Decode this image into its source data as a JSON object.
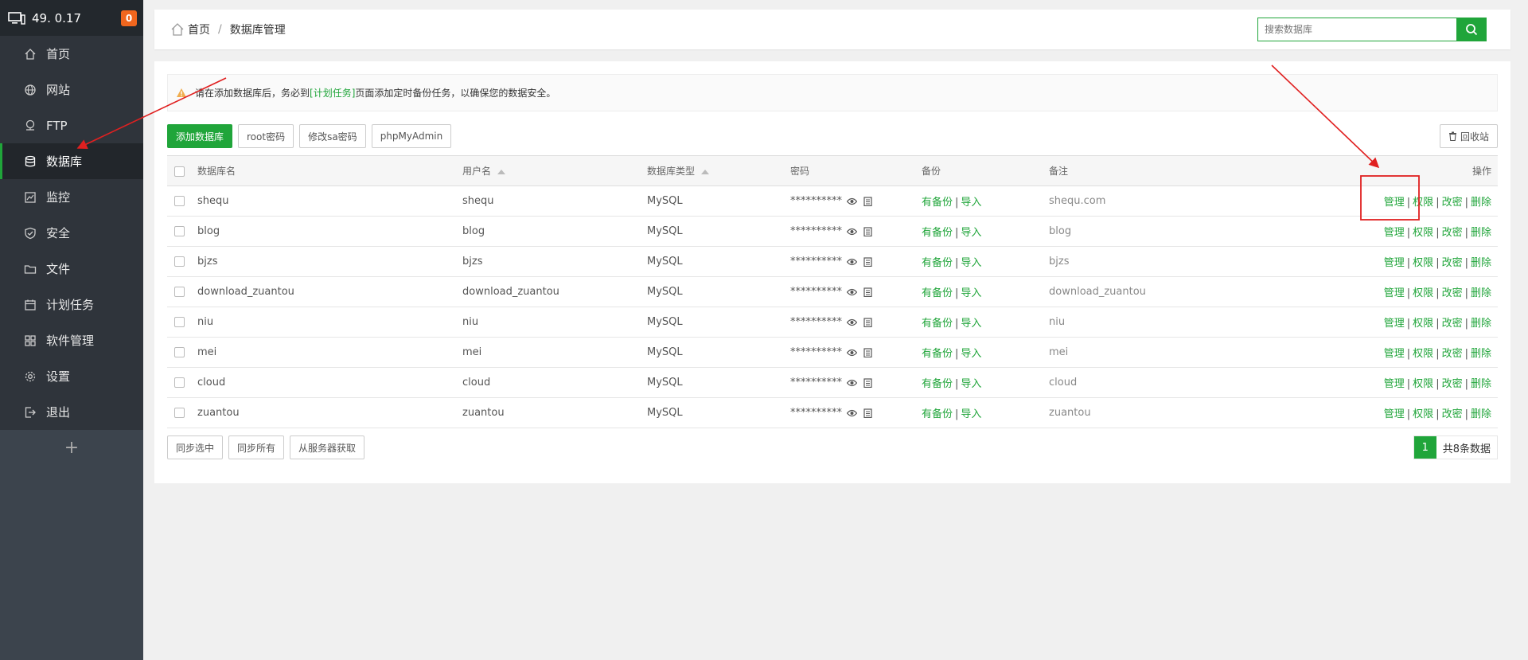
{
  "sidebar": {
    "ip": "49.    0.17",
    "badge": "0",
    "items": [
      {
        "label": "首页",
        "icon": "home-icon"
      },
      {
        "label": "网站",
        "icon": "globe-icon"
      },
      {
        "label": "FTP",
        "icon": "ftp-icon"
      },
      {
        "label": "数据库",
        "icon": "database-icon",
        "active": true
      },
      {
        "label": "监控",
        "icon": "monitor-icon"
      },
      {
        "label": "安全",
        "icon": "shield-icon"
      },
      {
        "label": "文件",
        "icon": "folder-icon"
      },
      {
        "label": "计划任务",
        "icon": "calendar-icon"
      },
      {
        "label": "软件管理",
        "icon": "apps-icon"
      },
      {
        "label": "设置",
        "icon": "gear-icon"
      },
      {
        "label": "退出",
        "icon": "logout-icon"
      }
    ],
    "add": "+"
  },
  "header": {
    "home": "首页",
    "sep": "/",
    "current": "数据库管理",
    "search_placeholder": "搜索数据库"
  },
  "alert": {
    "before": "请在添加数据库后，务必到",
    "link": "[计划任务]",
    "after": "页面添加定时备份任务，以确保您的数据安全。"
  },
  "toolbar": {
    "add": "添加数据库",
    "root": "root密码",
    "sa": "修改sa密码",
    "pma": "phpMyAdmin",
    "recycle": "回收站"
  },
  "table": {
    "headers": {
      "name": "数据库名",
      "user": "用户名",
      "type": "数据库类型",
      "password": "密码",
      "backup": "备份",
      "remark": "备注",
      "ops": "操作"
    },
    "backup_has": "有备份",
    "backup_import": "导入",
    "ops": {
      "manage": "管理",
      "perm": "权限",
      "pwd": "改密",
      "del": "删除"
    },
    "rows": [
      {
        "name": "shequ",
        "user": "shequ",
        "type": "MySQL",
        "password": "**********",
        "remark": "shequ.com"
      },
      {
        "name": "blog",
        "user": "blog",
        "type": "MySQL",
        "password": "**********",
        "remark": "blog"
      },
      {
        "name": "bjzs",
        "user": "bjzs",
        "type": "MySQL",
        "password": "**********",
        "remark": "bjzs"
      },
      {
        "name": "download_zuantou",
        "user": "download_zuantou",
        "type": "MySQL",
        "password": "**********",
        "remark": "download_zuantou"
      },
      {
        "name": "niu",
        "user": "niu",
        "type": "MySQL",
        "password": "**********",
        "remark": "niu"
      },
      {
        "name": "mei",
        "user": "mei",
        "type": "MySQL",
        "password": "**********",
        "remark": "mei"
      },
      {
        "name": "cloud",
        "user": "cloud",
        "type": "MySQL",
        "password": "**********",
        "remark": "cloud"
      },
      {
        "name": "zuantou",
        "user": "zuantou",
        "type": "MySQL",
        "password": "**********",
        "remark": "zuantou"
      }
    ]
  },
  "bottom": {
    "sync_selected": "同步选中",
    "sync_all": "同步所有",
    "fetch": "从服务器获取"
  },
  "pager": {
    "current": "1",
    "total": "共8条数据"
  },
  "colors": {
    "accent": "#20a53a",
    "sidebar": "#3c444d",
    "annotation": "#e02020"
  }
}
